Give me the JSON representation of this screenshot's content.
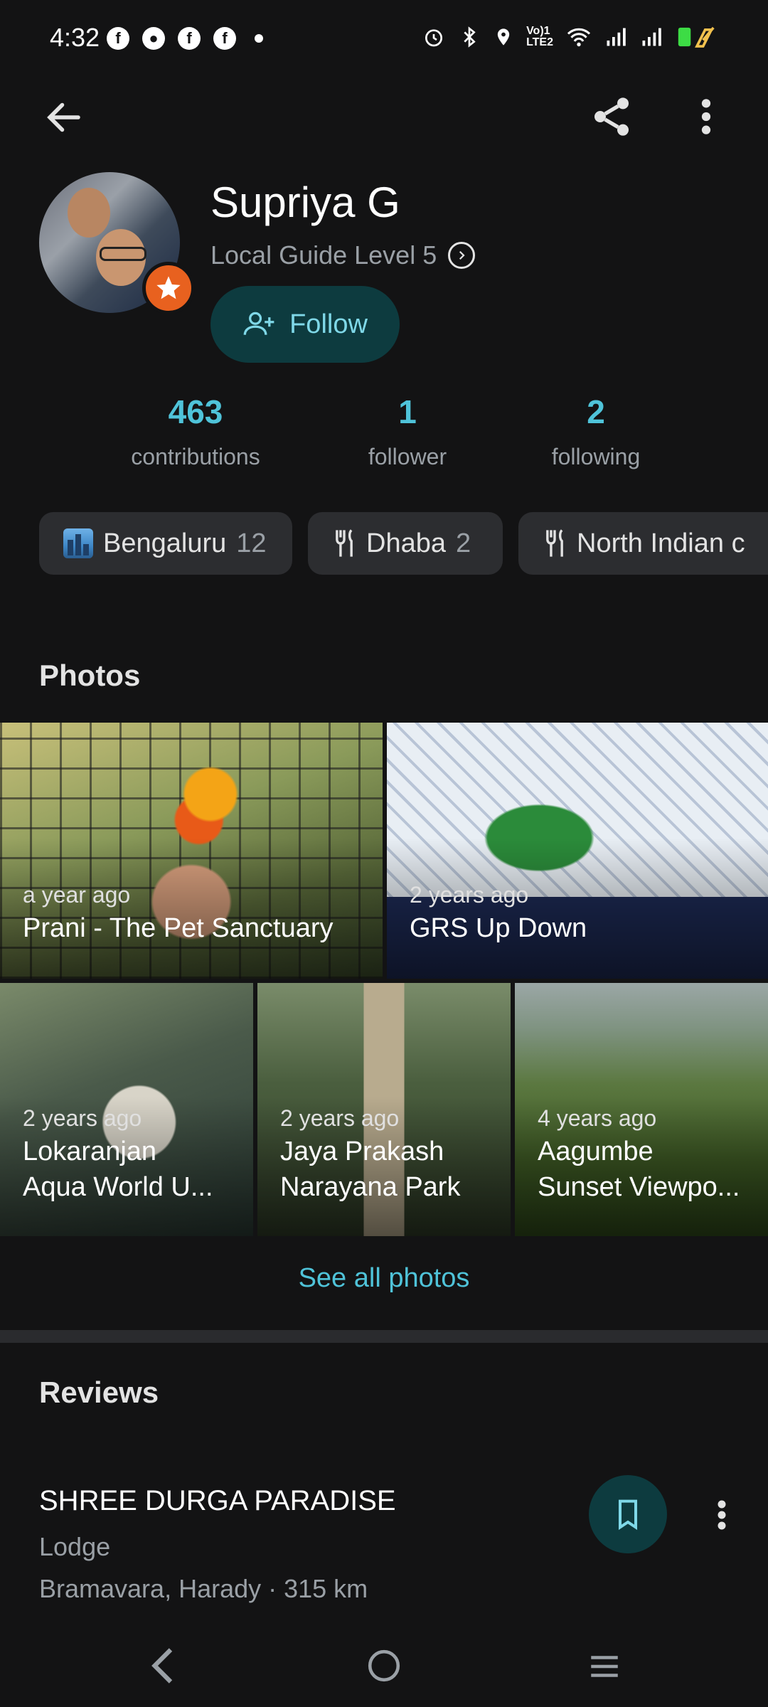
{
  "status_bar": {
    "time": "4:32",
    "left_icons": [
      "facebook-messenger-icon",
      "chat-bubble-icon",
      "facebook-icon",
      "facebook-icon"
    ],
    "right_icons": [
      "alarm-icon",
      "bluetooth-icon",
      "location-icon",
      "volte-icon",
      "wifi-icon",
      "signal-icon",
      "signal-icon",
      "battery-charging-icon"
    ],
    "volte_text": "Vo) 1\nLTE2"
  },
  "profile": {
    "name": "Supriya G",
    "level": "Local Guide Level 5",
    "follow_label": "Follow"
  },
  "stats": [
    {
      "value": "463",
      "label": "contributions"
    },
    {
      "value": "1",
      "label": "follower"
    },
    {
      "value": "2",
      "label": "following"
    }
  ],
  "chips": [
    {
      "label": "Bengaluru",
      "count": "12",
      "icon": "city-icon"
    },
    {
      "label": "Dhaba",
      "count": "2",
      "icon": "restaurant-icon"
    },
    {
      "label": "North Indian c",
      "count": "",
      "icon": "restaurant-icon"
    }
  ],
  "photos": {
    "title": "Photos",
    "items": [
      {
        "date": "a year ago",
        "title": "Prani - The Pet Sanctuary"
      },
      {
        "date": "2 years ago",
        "title": "GRS Up Down"
      },
      {
        "date": "2 years ago",
        "title_line1": "Lokaranjan",
        "title_line2": "Aqua World U..."
      },
      {
        "date": "2 years ago",
        "title_line1": "Jaya Prakash",
        "title_line2": "Narayana Park"
      },
      {
        "date": "4 years ago",
        "title_line1": "Aagumbe",
        "title_line2": "Sunset Viewpo..."
      }
    ],
    "see_all": "See all photos"
  },
  "reviews": {
    "title": "Reviews",
    "items": [
      {
        "name": "SHREE DURGA PARADISE",
        "type": "Lodge",
        "location": "Bramavara, Harady · 315 km"
      }
    ]
  },
  "colors": {
    "background": "#131314",
    "accent": "#4fc3d9",
    "button_bg": "#0d3b3f",
    "badge": "#e8611f"
  }
}
